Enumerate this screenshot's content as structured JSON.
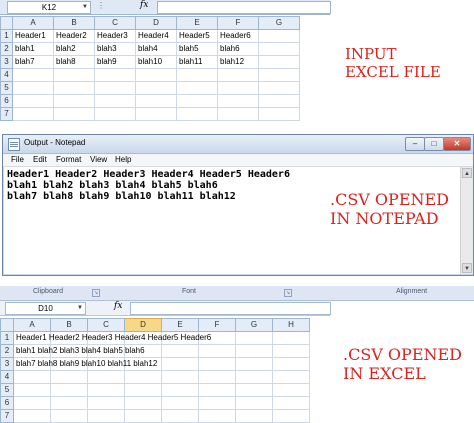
{
  "top_sheet": {
    "name_box": "K12",
    "formula": "",
    "columns": [
      "A",
      "B",
      "C",
      "D",
      "E",
      "F",
      "G"
    ],
    "rows": [
      {
        "num": "1",
        "cells": [
          "Header1",
          "Header2",
          "Header3",
          "Header4",
          "Header5",
          "Header6",
          ""
        ]
      },
      {
        "num": "2",
        "cells": [
          "blah1",
          "blah2",
          "blah3",
          "blah4",
          "blah5",
          "blah6",
          ""
        ]
      },
      {
        "num": "3",
        "cells": [
          "blah7",
          "blah8",
          "blah9",
          "blah10",
          "blah11",
          "blah12",
          ""
        ]
      },
      {
        "num": "4",
        "cells": [
          "",
          "",
          "",
          "",
          "",
          "",
          ""
        ]
      },
      {
        "num": "5",
        "cells": [
          "",
          "",
          "",
          "",
          "",
          "",
          ""
        ]
      },
      {
        "num": "6",
        "cells": [
          "",
          "",
          "",
          "",
          "",
          "",
          ""
        ]
      },
      {
        "num": "7",
        "cells": [
          "",
          "",
          "",
          "",
          "",
          "",
          ""
        ]
      }
    ]
  },
  "labels": {
    "input": "INPUT\nEXCEL FILE",
    "notepad": ".CSV OPENED\nIN NOTEPAD",
    "excel": ".CSV OPENED\nIN EXCEL"
  },
  "notepad": {
    "title": "Output - Notepad",
    "menu": [
      "File",
      "Edit",
      "Format",
      "View",
      "Help"
    ],
    "lines": [
      "Header1 Header2 Header3 Header4 Header5 Header6",
      "blah1 blah2 blah3 blah4 blah5 blah6",
      "blah7 blah8 blah9 blah10 blah11 blah12"
    ],
    "min_glyph": "–",
    "max_glyph": "□",
    "close_glyph": "✕"
  },
  "bottom_sheet": {
    "ribbon_groups": [
      "Clipboard",
      "Font",
      "Alignment"
    ],
    "name_box": "D10",
    "formula": "",
    "columns": [
      "A",
      "B",
      "C",
      "D",
      "E",
      "F",
      "G",
      "H"
    ],
    "selected_column": "D",
    "rows": [
      {
        "num": "1",
        "cells": [
          "Header1 Header2 Header3 Header4 Header5 Header6",
          "",
          "",
          "",
          "",
          "",
          "",
          ""
        ]
      },
      {
        "num": "2",
        "cells": [
          "blah1 blah2 blah3 blah4 blah5 blah6",
          "",
          "",
          "",
          "",
          "",
          "",
          ""
        ]
      },
      {
        "num": "3",
        "cells": [
          "blah7 blah8 blah9 blah10 blah11 blah12",
          "",
          "",
          "",
          "",
          "",
          "",
          ""
        ]
      },
      {
        "num": "4",
        "cells": [
          "",
          "",
          "",
          "",
          "",
          "",
          "",
          ""
        ]
      },
      {
        "num": "5",
        "cells": [
          "",
          "",
          "",
          "",
          "",
          "",
          "",
          ""
        ]
      },
      {
        "num": "6",
        "cells": [
          "",
          "",
          "",
          "",
          "",
          "",
          "",
          ""
        ]
      },
      {
        "num": "7",
        "cells": [
          "",
          "",
          "",
          "",
          "",
          "",
          "",
          ""
        ]
      }
    ]
  },
  "colors": {
    "label_red": "#e0201b",
    "header_bg": "#e4ecf7",
    "selected_header": "#f7d78a"
  },
  "icons": {
    "fx": "function-icon",
    "notepad": "notepad-icon",
    "dropdown": "chevron-down-icon"
  }
}
